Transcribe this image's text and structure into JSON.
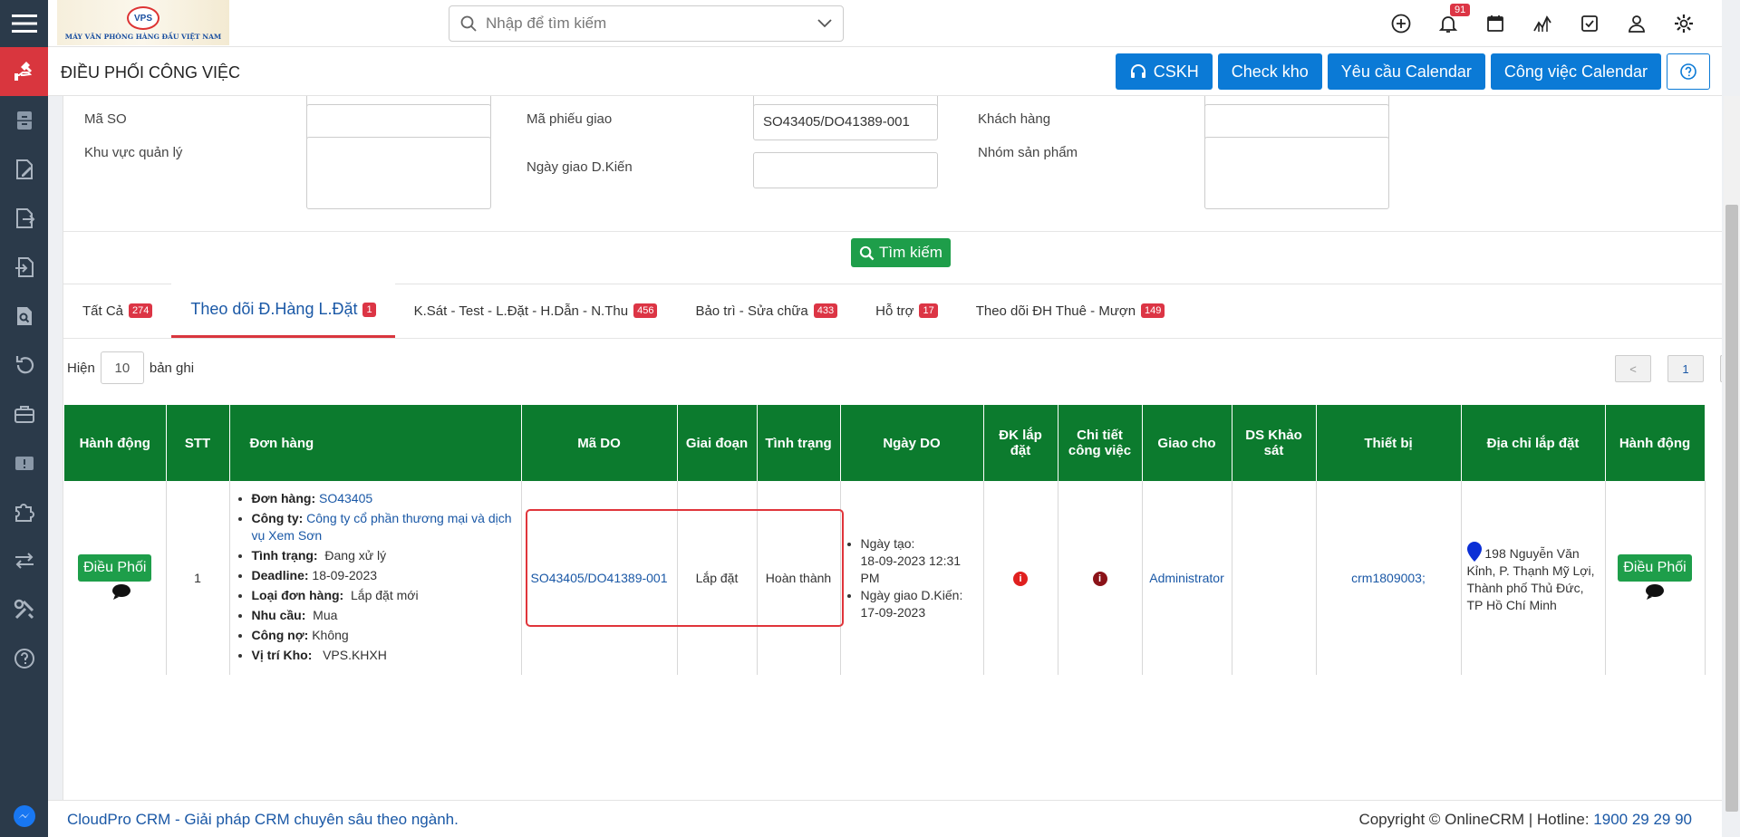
{
  "topbar": {
    "logo_short": "VPS",
    "logo_tagline": "MÁY VĂN PHÒNG HÀNG ĐẦU VIỆT NAM",
    "search_placeholder": "Nhập để tìm kiếm",
    "notification_count": "91"
  },
  "page": {
    "title": "ĐIỀU PHỐI CÔNG VIỆC",
    "buttons": {
      "cskh": "CSKH",
      "check_kho": "Check kho",
      "yeu_cau": "Yêu cầu Calendar",
      "cong_viec": "Công việc Calendar"
    }
  },
  "filters": {
    "ma_so_label": "Mã SO",
    "ma_so_value": "",
    "ma_phieu_label": "Mã phiếu giao",
    "ma_phieu_value": "SO43405/DO41389-001",
    "khach_hang_label": "Khách hàng",
    "khach_hang_value": "",
    "khu_vuc_label": "Khu vực quản lý",
    "ngay_giao_label": "Ngày giao D.Kiến",
    "ngay_giao_value": "",
    "nhom_sp_label": "Nhóm sản phẩm",
    "search_button": "Tìm kiếm"
  },
  "tabs": [
    {
      "label": "Tất Cả",
      "count": "274"
    },
    {
      "label": "Theo dõi Đ.Hàng L.Đặt",
      "count": "1"
    },
    {
      "label": "K.Sát - Test - L.Đặt - H.Dẫn - N.Thu",
      "count": "456"
    },
    {
      "label": "Bảo trì - Sửa chữa",
      "count": "433"
    },
    {
      "label": "Hỗ trợ",
      "count": "17"
    },
    {
      "label": "Theo dõi ĐH Thuê - Mượn",
      "count": "149"
    }
  ],
  "list": {
    "show_label": "Hiện",
    "show_value": "10",
    "records_label": "bản ghi",
    "page_prev": "<",
    "page_current": "1",
    "page_next": ">"
  },
  "table": {
    "headers": {
      "hanh_dong": "Hành động",
      "stt": "STT",
      "don_hang": "Đơn hàng",
      "ma_do": "Mã DO",
      "giai_doan": "Giai đoạn",
      "tinh_trang": "Tình trạng",
      "ngay_do": "Ngày DO",
      "dk_lap_dat": "ĐK lắp đặt",
      "chi_tiet": "Chi tiết công việc",
      "giao_cho": "Giao cho",
      "ds_khao_sat": "DS Khảo sát",
      "thiet_bi": "Thiết bị",
      "dia_chi": "Địa chỉ lắp đặt",
      "hanh_dong2": "Hành động"
    },
    "row": {
      "action": "Điều Phối",
      "stt": "1",
      "order_label": "Đơn hàng:",
      "order_value": "SO43405",
      "company_label": "Công ty:",
      "company_value": "Công ty cổ phần thương mại và dịch vụ Xem Sơn",
      "status_label": "Tình trạng:",
      "status_value": "Đang xử lý",
      "deadline_label": "Deadline:",
      "deadline_value": "18-09-2023",
      "type_label": "Loại đơn hàng:",
      "type_value": "Lắp đặt mới",
      "need_label": "Nhu cầu:",
      "need_value": "Mua",
      "debt_label": "Công nợ:",
      "debt_value": "Không",
      "warehouse_label": "Vị trí Kho:",
      "warehouse_value": "VPS.KHXH",
      "ma_do": "SO43405/DO41389-001",
      "giai_doan": "Lắp đặt",
      "tinh_trang": "Hoàn thành",
      "ngay_tao_label": "Ngày tạo:",
      "ngay_tao_value": "18-09-2023 12:31 PM",
      "ngay_giao_label": "Ngày giao D.Kiến:",
      "ngay_giao_value": "17-09-2023",
      "giao_cho": "Administrator",
      "ds_khao_sat": "",
      "thiet_bi": "crm1809003;",
      "dia_chi": "198 Nguyễn Văn Kỉnh, P. Thạnh Mỹ Lợi, Thành phố Thủ Đức, TP Hồ Chí Minh"
    }
  },
  "footer": {
    "left": "CloudPro CRM - Giải pháp CRM chuyên sâu theo ngành.",
    "right": "Copyright © OnlineCRM | Hotline:",
    "hotline": "1900 29 29 90"
  },
  "colors": {
    "sidebar": "#2b3a4a",
    "sidebar_active": "#d9363e",
    "primary": "#0b7ad6",
    "header_green": "#0c7b2e",
    "button_green": "#1e9e4a",
    "badge_red": "#dc3545",
    "link": "#1a58a6"
  }
}
